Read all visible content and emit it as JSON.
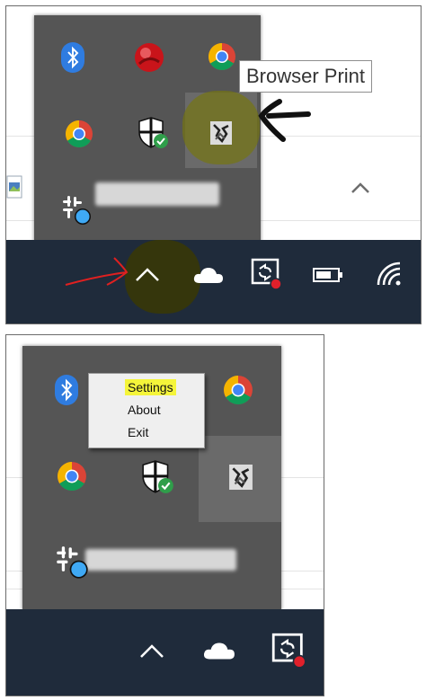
{
  "top_panel": {
    "tooltip": {
      "text": "Browser Print"
    },
    "tray_icons": [
      "bluetooth-icon",
      "antivirus-icon",
      "chrome-icon",
      "chrome-icon",
      "windows-security-icon",
      "browser-print-icon",
      "slack-icon"
    ],
    "taskbar_icons": [
      "show-hidden-icons-chevron",
      "onedrive-icon",
      "remote-desktop-icon",
      "battery-icon",
      "wifi-icon"
    ]
  },
  "bottom_panel": {
    "context_menu": {
      "items": [
        {
          "label": "Settings",
          "highlighted": true
        },
        {
          "label": "About",
          "highlighted": false
        },
        {
          "label": "Exit",
          "highlighted": false
        }
      ]
    },
    "tray_icons": [
      "bluetooth-icon",
      "chrome-icon",
      "chrome-icon",
      "windows-security-icon",
      "browser-print-icon",
      "slack-icon"
    ],
    "taskbar_icons": [
      "show-hidden-icons-chevron",
      "onedrive-icon",
      "remote-desktop-icon"
    ]
  },
  "colors": {
    "tray_background": "#555555",
    "taskbar_background": "#1f2b3b",
    "highlight_yellow": "#f5f53a",
    "annotation_red": "#e02020"
  }
}
